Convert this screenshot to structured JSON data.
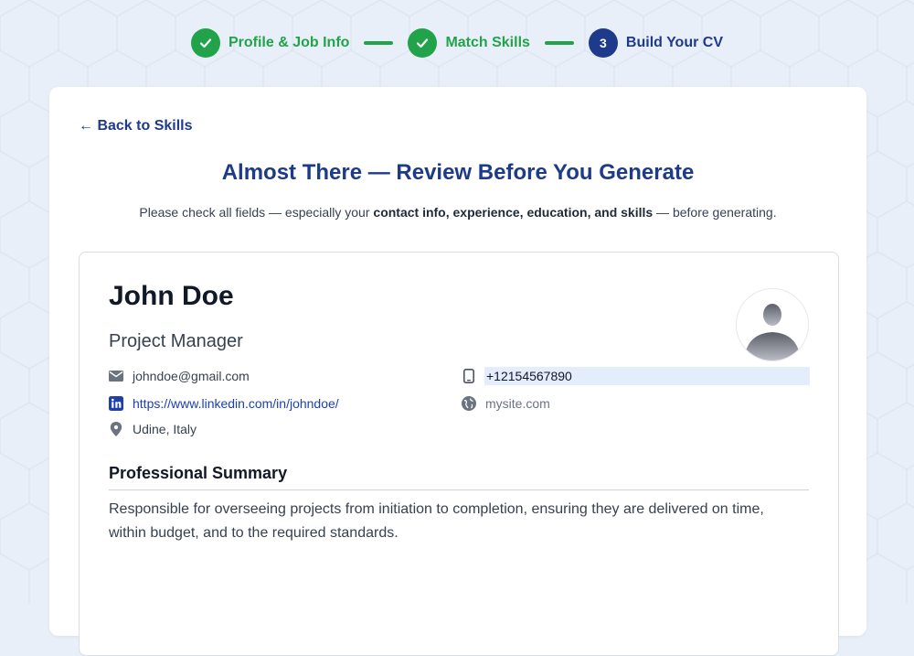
{
  "stepper": {
    "steps": [
      {
        "label": "Profile & Job Info",
        "state": "done"
      },
      {
        "label": "Match Skills",
        "state": "done"
      },
      {
        "label": "Build Your CV",
        "state": "active",
        "number": "3"
      }
    ]
  },
  "page": {
    "back_label": "← Back to Skills",
    "heading": "Almost There — Review Before You Generate",
    "subtext_pre": "Please check all fields — especially your ",
    "subtext_bold": "contact info, experience, education, and skills",
    "subtext_post": " — before generating."
  },
  "cv": {
    "name": "John Doe",
    "title": "Project Manager",
    "email": "johndoe@gmail.com",
    "linkedin": "https://www.linkedin.com/in/johndoe/",
    "location": "Udine, Italy",
    "phone": "+12154567890",
    "website_placeholder": "mysite.com",
    "summary_title": "Professional Summary",
    "summary": "Responsible for overseeing projects from initiation to completion, ensuring they are delivered on time, within budget, and to the required standards."
  },
  "icons": {
    "email": "mail-icon",
    "linkedin": "linkedin-icon",
    "location": "location-pin-icon",
    "phone": "phone-icon",
    "website": "globe-icon",
    "step_done": "check-icon"
  },
  "colors": {
    "brand_navy": "#1e3a8a",
    "success_green": "#22a34a",
    "link_blue": "#1e40af",
    "background": "#e9eff8"
  }
}
